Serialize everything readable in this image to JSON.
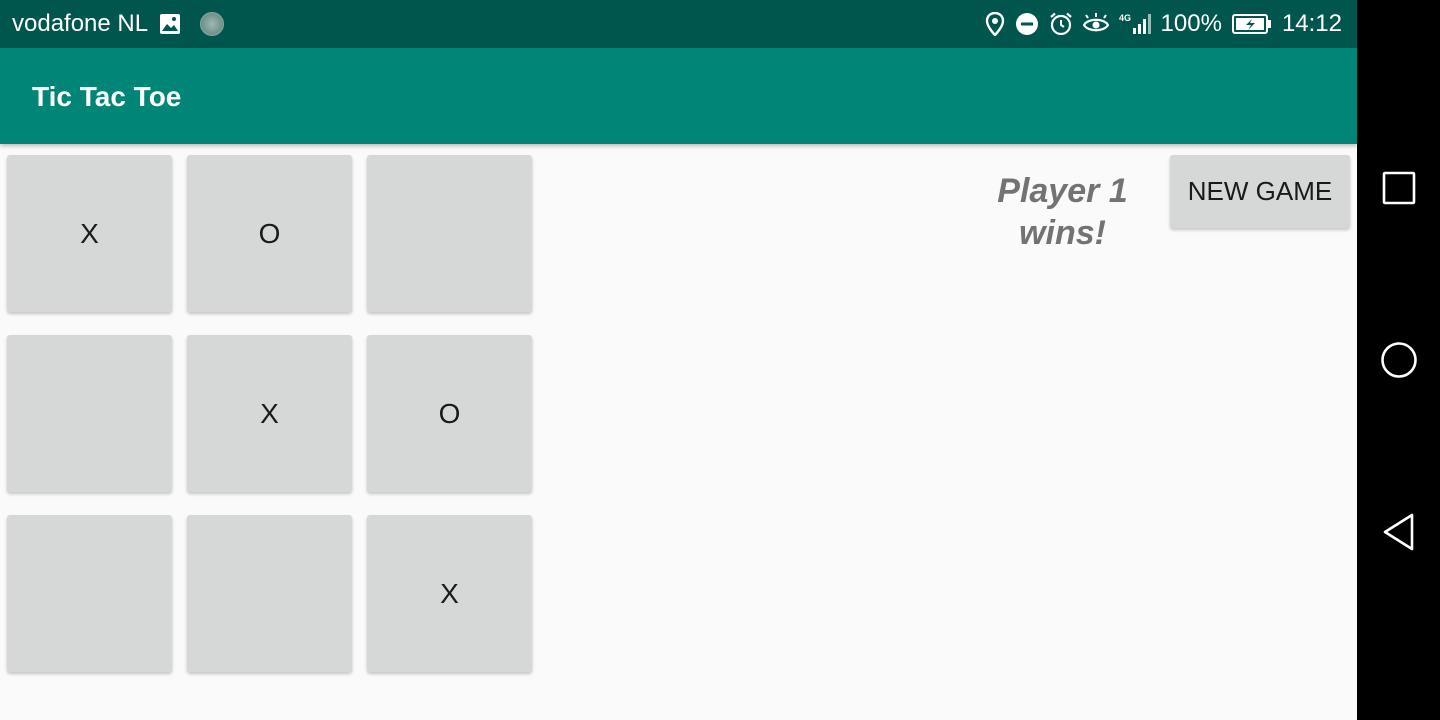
{
  "status_bar": {
    "carrier": "vodafone NL",
    "network": "4G",
    "battery_percent": "100%",
    "time": "14:12",
    "icons": [
      "image-icon",
      "sync-dot-icon",
      "location-icon",
      "do-not-disturb-icon",
      "alarm-icon",
      "eye-comfort-icon",
      "signal-icon",
      "battery-charging-icon"
    ]
  },
  "app_bar": {
    "title": "Tic Tac Toe"
  },
  "board": {
    "cells": [
      [
        "X",
        "O",
        ""
      ],
      [
        "",
        "X",
        "O"
      ],
      [
        "",
        "",
        "X"
      ]
    ]
  },
  "result": {
    "text": "Player 1 wins!"
  },
  "controls": {
    "new_game_label": "NEW GAME"
  },
  "nav_bar": {
    "icons": [
      "recents-square-icon",
      "home-circle-icon",
      "back-triangle-icon"
    ]
  },
  "colors": {
    "status_bar": "#00564c",
    "app_bar": "#008577",
    "background": "#fafafa",
    "cell": "#d6d7d7",
    "result_text": "#737373"
  }
}
